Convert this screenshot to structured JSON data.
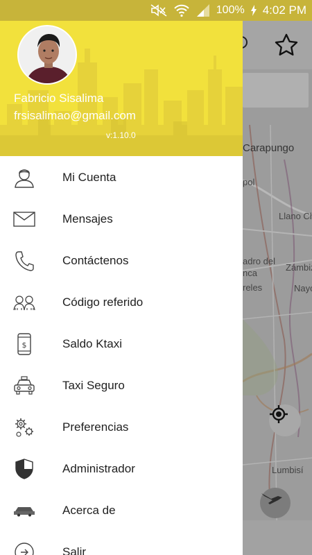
{
  "status_bar": {
    "battery_percent": "100%",
    "time": "4:02 PM",
    "icons": [
      "mute-icon",
      "wifi-icon",
      "signal-icon",
      "charging-icon"
    ]
  },
  "drawer": {
    "user_name": "Fabricio Sisalima",
    "user_email": "frsisalimao@gmail.com",
    "version": "v:1.10.0",
    "header_color": "#f2e13c",
    "items": [
      {
        "label": "Mi Cuenta",
        "icon": "user-icon"
      },
      {
        "label": "Mensajes",
        "icon": "envelope-icon"
      },
      {
        "label": "Contáctenos",
        "icon": "phone-icon"
      },
      {
        "label": "Código referido",
        "icon": "referral-people-icon"
      },
      {
        "label": "Saldo Ktaxi",
        "icon": "mobile-balance-icon"
      },
      {
        "label": "Taxi Seguro",
        "icon": "taxi-icon"
      },
      {
        "label": "Preferencias",
        "icon": "gears-icon"
      },
      {
        "label": "Administrador",
        "icon": "shield-icon"
      },
      {
        "label": "Acerca de",
        "icon": "express-legal-logo-icon"
      },
      {
        "label": "Salir",
        "icon": "exit-icon"
      }
    ]
  },
  "map": {
    "labels": [
      "Carapungo",
      "Llano Chic",
      "adro del",
      "Zámbiz",
      "nca",
      "Nayó",
      "reles",
      "Lumbisí",
      "pol"
    ]
  }
}
